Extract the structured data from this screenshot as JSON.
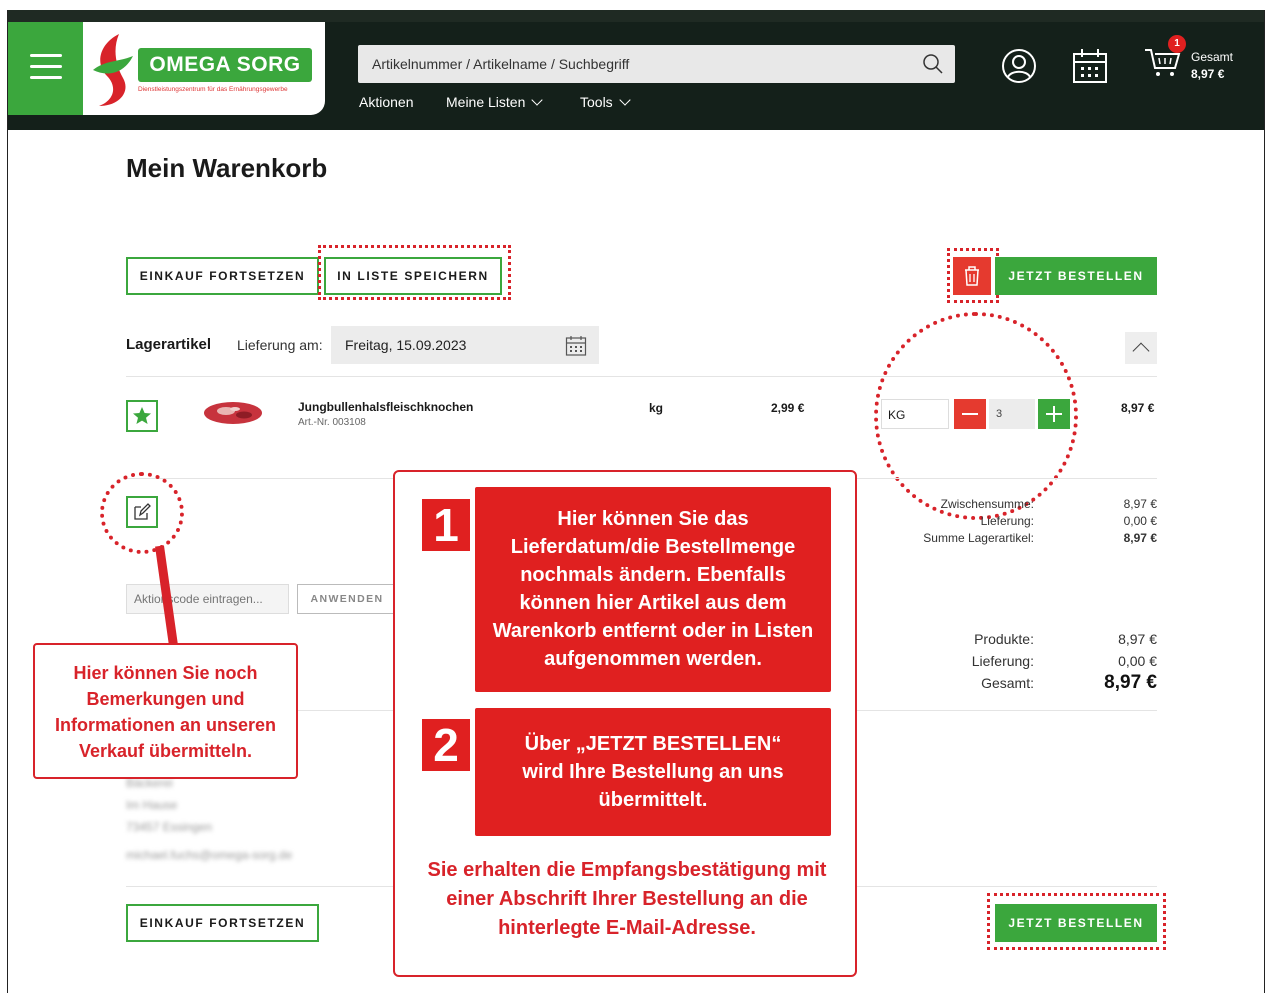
{
  "header": {
    "brand": "OMEGA SORG",
    "tagline": "Dienstleistungszentrum für das Ernährungsgewerbe",
    "search_placeholder": "Artikelnummer / Artikelname / Suchbegriff",
    "nav": [
      "Aktionen",
      "Meine Listen",
      "Tools"
    ],
    "cart_count": "1",
    "total_label": "Gesamt",
    "total_value": "8,97 €"
  },
  "page": {
    "title": "Mein Warenkorb",
    "continue_label": "EINKAUF FORTSETZEN",
    "save_list_label": "IN LISTE SPEICHERN",
    "order_label": "JETZT BESTELLEN"
  },
  "section": {
    "title": "Lagerartikel",
    "delivery_label": "Lieferung am:",
    "delivery_date": "Freitag, 15.09.2023"
  },
  "item": {
    "name": "Jungbullenhalsfleischknochen",
    "article": "Art.-Nr. 003108",
    "unit": "kg",
    "price": "2,99 €",
    "unit_select": "KG",
    "quantity": "3",
    "total": "8,97 €"
  },
  "subtotals": {
    "rows": [
      {
        "label": "Zwischensumme:",
        "value": "8,97 €"
      },
      {
        "label": "Lieferung:",
        "value": "0,00 €"
      },
      {
        "label": "Summe Lagerartikel:",
        "value": "8,97 €"
      }
    ]
  },
  "coupon": {
    "placeholder": "Aktionscode eintragen...",
    "apply_label": "ANWENDEN"
  },
  "totals": {
    "rows": [
      {
        "label": "Produkte:",
        "value": "8,97 €"
      },
      {
        "label": "Lieferung:",
        "value": "0,00 €"
      },
      {
        "label": "Gesamt:",
        "value": "8,97 €"
      }
    ]
  },
  "address_blurred": [
    "Bäckerei",
    "Im Hause",
    "73457 Essingen",
    "michael.fuchs@omega-sorg.de"
  ],
  "callouts": {
    "left": "Hier können Sie noch Bemerkungen und Informationen an unseren Verkauf übermitteln.",
    "step1_num": "1",
    "step1": "Hier können Sie das Lieferdatum/die Bestellmenge nochmals ändern. Ebenfalls können hier Artikel aus dem Warenkorb entfernt oder in Listen aufgenommen werden.",
    "step2_num": "2",
    "step2": "Über „JETZT BESTELLEN“ wird Ihre Bestellung an uns übermittelt.",
    "footer": "Sie erhalten die Empfangsbestätigung mit einer Abschrift Ihrer Bestellung an die hinterlegte E-Mail-Adresse."
  },
  "colors": {
    "brand_green": "#3ba73d",
    "accent_red": "#e02020",
    "header_bg": "#14201a"
  }
}
